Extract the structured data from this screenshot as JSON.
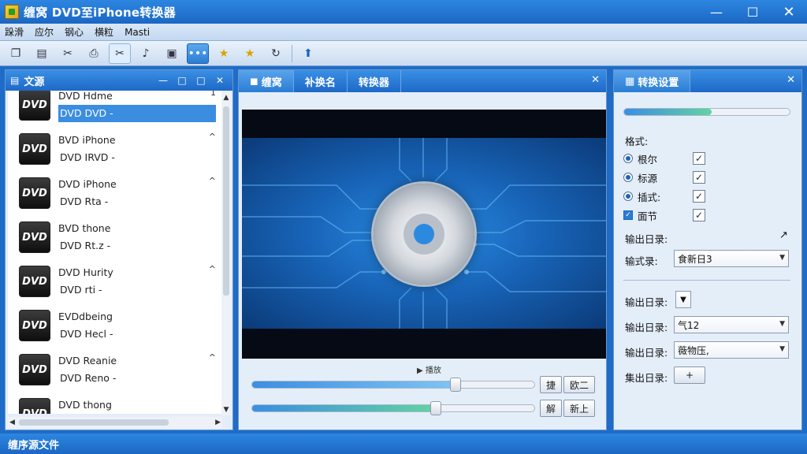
{
  "window": {
    "title": "缠窝 DVD至iPhone转换器"
  },
  "window_controls": {
    "minimize": "—",
    "maximize": "☐",
    "close": "✕"
  },
  "menu": [
    "跺滑",
    "应尔",
    "钢心",
    "横粒",
    "Masti"
  ],
  "toolbar": [
    {
      "icon": "copy-icon",
      "glyph": "❐"
    },
    {
      "icon": "folder-icon",
      "glyph": "▤"
    },
    {
      "icon": "link-icon",
      "glyph": "✂"
    },
    {
      "icon": "print-icon",
      "glyph": "⎙"
    },
    {
      "icon": "cut-icon",
      "glyph": "✂"
    },
    {
      "icon": "bell-icon",
      "glyph": "♪"
    },
    {
      "icon": "image-icon",
      "glyph": "▣"
    },
    {
      "icon": "more-icon",
      "glyph": "•••"
    },
    {
      "icon": "star-icon",
      "glyph": "★"
    },
    {
      "icon": "star-plus-icon",
      "glyph": "★"
    },
    {
      "icon": "refresh-icon",
      "glyph": "↻"
    },
    {
      "icon": "upload-icon",
      "glyph": "⬆"
    }
  ],
  "source_panel": {
    "title": "文源",
    "controls": {
      "minimize": "—",
      "restore": "□",
      "maximize": "□",
      "close": "✕"
    },
    "items": [
      {
        "thumb": "DVD",
        "line1": "DVD Hdme",
        "line2": "DVD DVD -",
        "expand": "1",
        "selected": true
      },
      {
        "thumb": "DVD",
        "line1": "BVD iPhone",
        "line2": "DVD IRVD -",
        "expand": "^",
        "selected": false
      },
      {
        "thumb": "DVD",
        "line1": "DVD iPhone",
        "line2": "DVD Rta -",
        "expand": "^",
        "selected": false
      },
      {
        "thumb": "DVD",
        "line1": "BVD thone",
        "line2": "DVD Rt.z -",
        "expand": "",
        "selected": false
      },
      {
        "thumb": "DVD",
        "line1": "DVD Hurity",
        "line2": "DVD rti -",
        "expand": "^",
        "selected": false
      },
      {
        "thumb": "DVD",
        "line1": "EVDdbeing",
        "line2": "DVD Hecl -",
        "expand": "",
        "selected": false
      },
      {
        "thumb": "DVD",
        "line1": "DVD Reanie",
        "line2": "DVD Reno -",
        "expand": "^",
        "selected": false
      },
      {
        "thumb": "DVD",
        "line1": "DVD thong",
        "line2": "",
        "expand": "",
        "selected": false
      }
    ]
  },
  "preview_panel": {
    "tabs": [
      "缠窝",
      "补换名",
      "转换器"
    ],
    "close": "✕",
    "play_label": "▶ 播放",
    "seek_progress": 0.72,
    "volume_progress": 0.65,
    "buttons": {
      "a_icon": "捷",
      "a_label": "欧二",
      "b_icon": "解",
      "b_label": "新上"
    }
  },
  "settings_panel": {
    "title": "转换设置",
    "close": "✕",
    "progress": 0.53,
    "format_label": "格式:",
    "options": [
      {
        "type": "radio",
        "label": "根尔",
        "checked": "✓"
      },
      {
        "type": "radio",
        "label": "标源",
        "checked": "✓"
      },
      {
        "type": "radio",
        "label": "插式:",
        "checked": "✓"
      },
      {
        "type": "square",
        "label": "面节",
        "checked": "✓"
      }
    ],
    "output_dir_label": "输出日录:",
    "output_dir_icon": "↗",
    "output_format_label": "输式录:",
    "output_format_value": "食新日3",
    "rows": [
      {
        "label": "输出日录:",
        "value": "",
        "kind": "caret"
      },
      {
        "label": "输出日录:",
        "value": "气12",
        "kind": "dropdown"
      },
      {
        "label": "输出日录:",
        "value": "薇物压,",
        "kind": "dropdown"
      },
      {
        "label": "集出日录:",
        "value": "+",
        "kind": "plus"
      }
    ]
  },
  "status": {
    "text": "缠序源文件"
  },
  "colors": {
    "accent": "#1e6cc8",
    "selection": "#3b8de0",
    "panel_bg": "#e4eef9"
  }
}
